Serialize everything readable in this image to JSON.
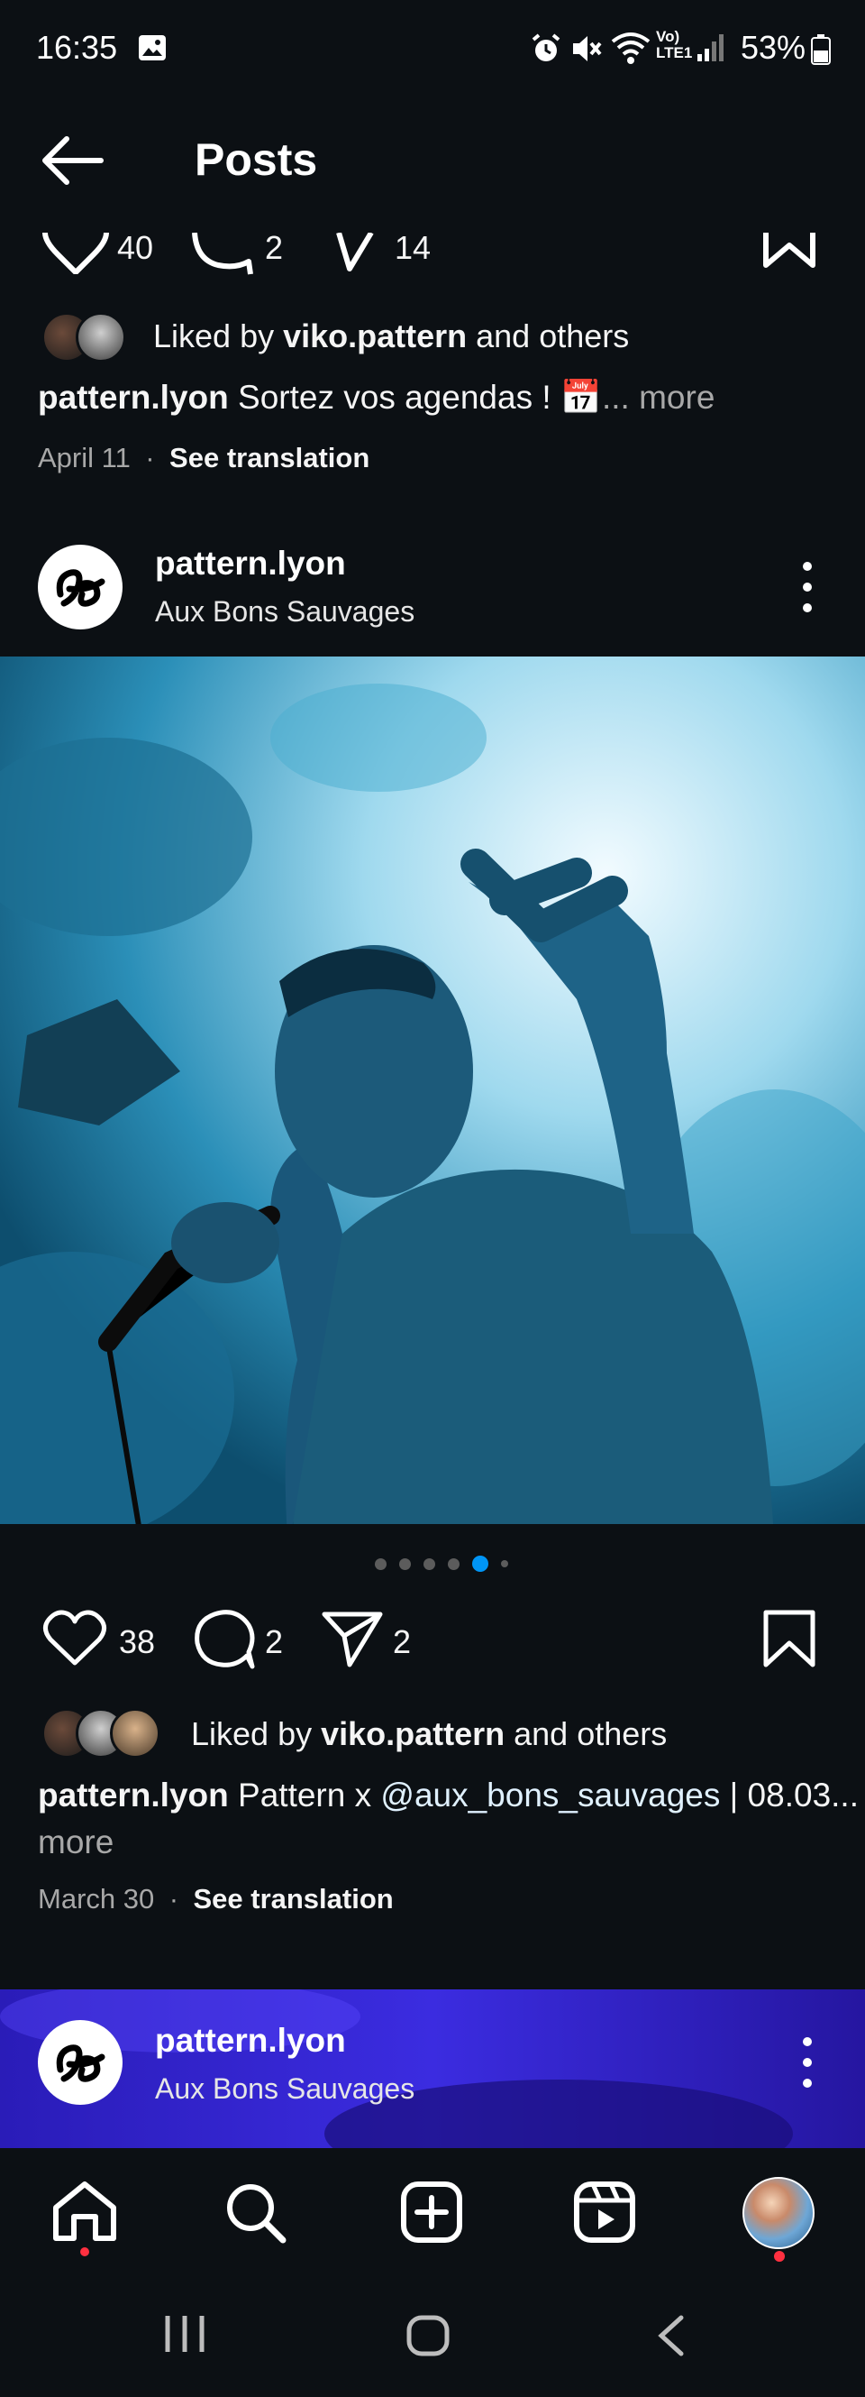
{
  "status_bar": {
    "time": "16:35",
    "battery": "53%",
    "icons": [
      "gallery-icon",
      "alarm-icon",
      "mute-icon",
      "wifi-icon",
      "volte-icon",
      "signal-icon",
      "battery-icon"
    ]
  },
  "header": {
    "title": "Posts"
  },
  "post1": {
    "likes": "40",
    "comments": "2",
    "shares": "14",
    "liked_by_prefix": "Liked by ",
    "liked_by_user": "viko.pattern",
    "liked_by_suffix": " and others",
    "caption_user": "pattern.lyon",
    "caption_text": "Sortez vos agendas ! 📅",
    "caption_more": "... more",
    "date": "April 11",
    "see_translation": "See translation"
  },
  "post2": {
    "username": "pattern.lyon",
    "location": "Aux Bons Sauvages",
    "carousel_count": 6,
    "carousel_active": 5,
    "likes": "38",
    "comments": "2",
    "shares": "2",
    "liked_by_prefix": "Liked by ",
    "liked_by_user": "viko.pattern",
    "liked_by_suffix": " and others",
    "caption_user": "pattern.lyon",
    "caption_text": "Pattern x ",
    "caption_mention": "@aux_bons_sauvages",
    "caption_rest": " | 08.03...",
    "caption_more": "more",
    "date": "March 30",
    "see_translation": "See translation"
  },
  "post3": {
    "username": "pattern.lyon",
    "location": "Aux Bons Sauvages"
  },
  "bottom_nav": [
    "home-icon",
    "search-icon",
    "create-icon",
    "reels-icon",
    "profile-avatar"
  ],
  "colors": {
    "background": "#0c1014",
    "accent": "#0095f6",
    "notification": "#ff3040",
    "mention": "#e0f1ff"
  }
}
